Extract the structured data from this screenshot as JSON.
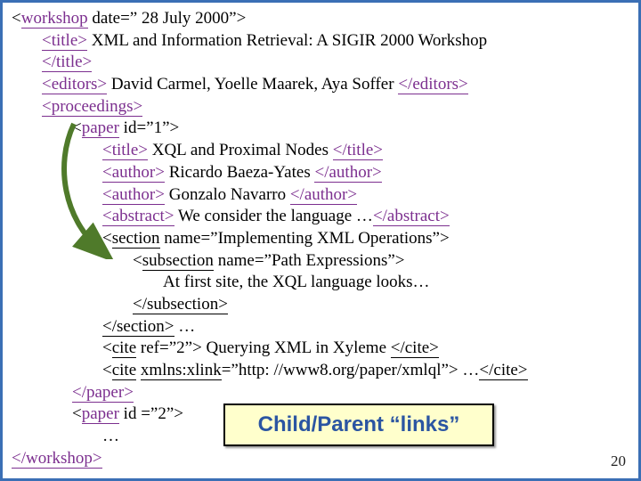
{
  "slide": {
    "page_number": "20",
    "callout": "Child/Parent “links”"
  },
  "xml": {
    "workshop_open_pre": "<",
    "workshop_tag": "workshop",
    "workshop_attr": " date=” 28 July 2000”>",
    "title_open": "<title>",
    "title_text": " XML and Information Retrieval: A SIGIR 2000 Workshop ",
    "title_close": "</title>",
    "editors_open": "<editors>",
    "editors_text": " David Carmel, Yoelle Maarek, Aya Soffer ",
    "editors_close": "</editors>",
    "proceedings_open": "<proceedings>",
    "paper1_open_pre": "<",
    "paper1_tag": "paper",
    "paper1_attr": " id=”1”>",
    "paper1_title_open": "<title>",
    "paper1_title_text": " XQL and Proximal Nodes ",
    "paper1_title_close": "</title>",
    "author1_open": "<author>",
    "author1_text": " Ricardo Baeza-Yates ",
    "author1_close": "</author>",
    "author2_open": "<author>",
    "author2_text": " Gonzalo Navarro ",
    "author2_close": "</author>",
    "abstract_open": "<abstract>",
    "abstract_text": " We consider the language …",
    "abstract_close": "</abstract>",
    "section_open_pre": "<",
    "section_tag": "section",
    "section_attr": " name=”Implementing XML Operations”>",
    "subsection_open_pre": "<",
    "subsection_tag": "subsection",
    "subsection_attr": " name=”Path Expressions”>",
    "subsection_text": "At first site, the XQL language looks…",
    "subsection_close": "</subsection>",
    "section_close": "</section>",
    "section_after": " …",
    "cite1_open_pre": "<",
    "cite1_tag": "cite",
    "cite1_attr": " ref=”2”>",
    "cite1_text": " Querying XML in Xyleme ",
    "cite1_close": "</cite>",
    "cite2_open_pre": "<",
    "cite2_tag": "cite",
    "cite2_space": " ",
    "cite2_xlink": "xmlns:xlink",
    "cite2_attr": "=”http: //www8.org/paper/xmlql”>",
    "cite2_text": " …",
    "cite2_close": "</cite>",
    "paper1_close": "</paper>",
    "paper2_open_pre": "<",
    "paper2_tag": "paper",
    "paper2_attr": " id =”2”>",
    "ellipsis": "…",
    "workshop_close": "</workshop>"
  }
}
